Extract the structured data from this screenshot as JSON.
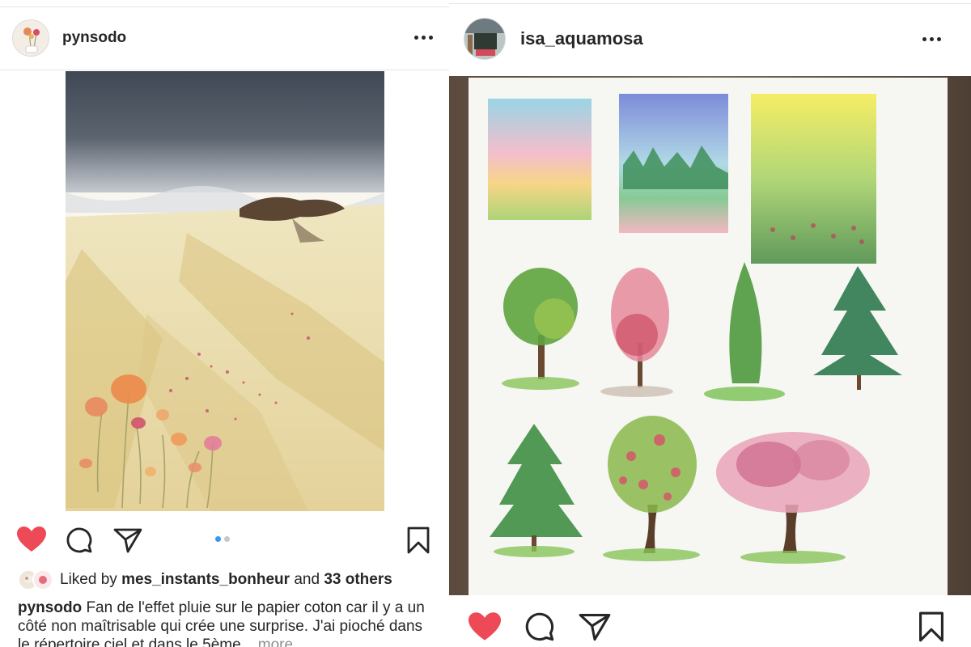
{
  "left_post": {
    "username": "pynsodo",
    "liked_by_prefix": "Liked by",
    "liked_by_user": "mes_instants_bonheur",
    "liked_by_and": "and",
    "liked_by_others": "33 others",
    "caption_user": "pynsodo",
    "caption_text": "Fan de l'effet pluie sur le papier coton car il y a un côté non maîtrisable qui crée une surprise. J'ai pioché dans le répertoire ciel et dans le 5ème...",
    "more_label": "more",
    "carousel": {
      "count": 2,
      "active": 0
    },
    "liked": true
  },
  "right_post": {
    "username": "isa_aquamosa",
    "liked": true
  },
  "icons": {
    "like": "heart-icon",
    "comment": "comment-icon",
    "share": "send-icon",
    "save": "bookmark-icon",
    "options": "more-options-icon"
  },
  "colors": {
    "heart": "#ed4956",
    "text": "#262626",
    "muted": "#8e8e8e",
    "dot_active": "#3897f0",
    "dot_inactive": "#c7c7c7"
  }
}
